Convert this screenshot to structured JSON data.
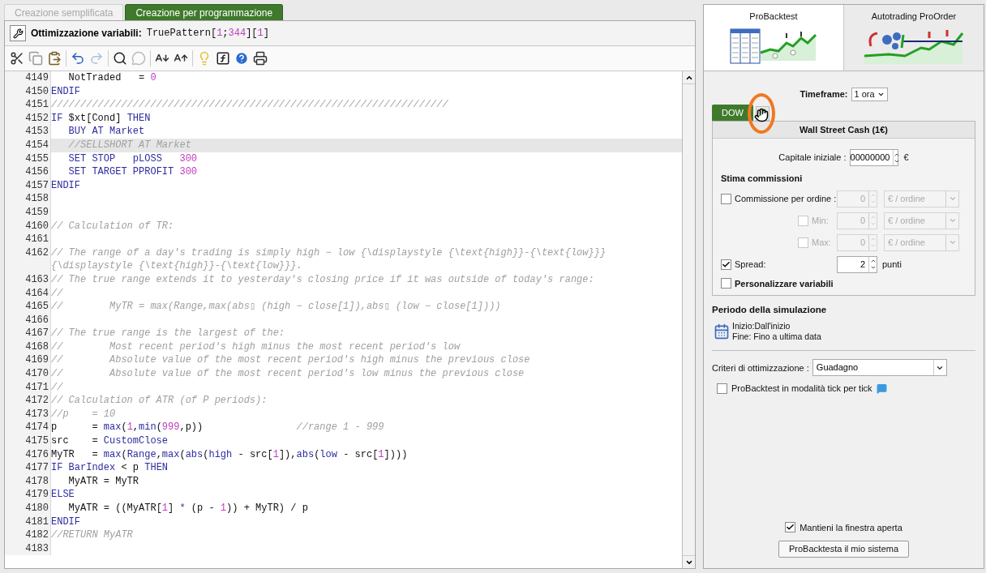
{
  "tabs": [
    {
      "label": "Creazione semplificata",
      "selected": false
    },
    {
      "label": "Creazione per programmazione",
      "selected": true
    }
  ],
  "optimization": {
    "label": "Ottimizzazione variabili:",
    "tokens": [
      {
        "kind": "plain",
        "text": "TruePattern["
      },
      {
        "kind": "num",
        "text": "1"
      },
      {
        "kind": "plain",
        "text": ";"
      },
      {
        "kind": "num",
        "text": "344"
      },
      {
        "kind": "plain",
        "text": "]["
      },
      {
        "kind": "num",
        "text": "1"
      },
      {
        "kind": "plain",
        "text": "]"
      }
    ]
  },
  "code_lines": [
    {
      "number": "4149",
      "highlighted": false,
      "tokens": [
        {
          "kind": "plain",
          "text": "   NotTraded   = "
        },
        {
          "kind": "num",
          "text": "0"
        }
      ]
    },
    {
      "number": "4150",
      "highlighted": false,
      "tokens": [
        {
          "kind": "kw",
          "text": "ENDIF"
        }
      ]
    },
    {
      "number": "4151",
      "highlighted": false,
      "tokens": [
        {
          "kind": "comment",
          "text": "////////////////////////////////////////////////////////////////////"
        }
      ]
    },
    {
      "number": "4152",
      "highlighted": false,
      "tokens": [
        {
          "kind": "kw",
          "text": "IF"
        },
        {
          "kind": "plain",
          "text": " $xt[Cond] "
        },
        {
          "kind": "kw",
          "text": "THEN"
        }
      ]
    },
    {
      "number": "4153",
      "highlighted": false,
      "tokens": [
        {
          "kind": "kw",
          "text": "   BUY AT Market"
        }
      ]
    },
    {
      "number": "4154",
      "highlighted": true,
      "tokens": [
        {
          "kind": "comment",
          "text": "   //SELLSHORT AT Market"
        }
      ]
    },
    {
      "number": "4155",
      "highlighted": false,
      "tokens": [
        {
          "kind": "kw",
          "text": "   SET STOP   pLOSS"
        },
        {
          "kind": "num",
          "text": "   300"
        }
      ]
    },
    {
      "number": "4156",
      "highlighted": false,
      "tokens": [
        {
          "kind": "kw",
          "text": "   SET TARGET PPROFIT"
        },
        {
          "kind": "num",
          "text": " 300"
        }
      ]
    },
    {
      "number": "4157",
      "highlighted": false,
      "tokens": [
        {
          "kind": "kw",
          "text": "ENDIF"
        }
      ]
    },
    {
      "number": "4158",
      "highlighted": false
    },
    {
      "number": "4159",
      "highlighted": false
    },
    {
      "number": "4160",
      "highlighted": false,
      "tokens": [
        {
          "kind": "comment",
          "text": "// Calculation of TR:"
        }
      ]
    },
    {
      "number": "4161",
      "highlighted": false
    },
    {
      "number": "4162",
      "highlighted": false,
      "tokens": [
        {
          "kind": "comment",
          "text": "// The range of a day's trading is simply high − low {\\displaystyle {\\text{high}}-{\\text{low}}} {\\displaystyle {\\text{high}}-{\\text{low}}}."
        }
      ]
    },
    {
      "number": "4163",
      "highlighted": false,
      "tokens": [
        {
          "kind": "comment",
          "text": "// The true range extends it to yesterday's closing price if it was outside of today's range:"
        }
      ]
    },
    {
      "number": "4164",
      "highlighted": false,
      "tokens": [
        {
          "kind": "comment",
          "text": "//"
        }
      ]
    },
    {
      "number": "4165",
      "highlighted": false,
      "tokens": [
        {
          "kind": "comment",
          "text": "//        MyTR = max(Range,max(abs▯ (high − close[1]),abs▯ (low − close[1])))"
        }
      ]
    },
    {
      "number": "4166",
      "highlighted": false
    },
    {
      "number": "4167",
      "highlighted": false,
      "tokens": [
        {
          "kind": "comment",
          "text": "// The true range is the largest of the:"
        }
      ]
    },
    {
      "number": "4168",
      "highlighted": false,
      "tokens": [
        {
          "kind": "comment",
          "text": "//        Most recent period's high minus the most recent period's low"
        }
      ]
    },
    {
      "number": "4169",
      "highlighted": false,
      "tokens": [
        {
          "kind": "comment",
          "text": "//        Absolute value of the most recent period's high minus the previous close"
        }
      ]
    },
    {
      "number": "4170",
      "highlighted": false,
      "tokens": [
        {
          "kind": "comment",
          "text": "//        Absolute value of the most recent period's low minus the previous close"
        }
      ]
    },
    {
      "number": "4171",
      "highlighted": false,
      "tokens": [
        {
          "kind": "comment",
          "text": "//"
        }
      ]
    },
    {
      "number": "4172",
      "highlighted": false,
      "tokens": [
        {
          "kind": "comment",
          "text": "// Calculation of ATR (of P periods):"
        }
      ]
    },
    {
      "number": "4173",
      "highlighted": false,
      "tokens": [
        {
          "kind": "comment",
          "text": "//p    = 10"
        }
      ]
    },
    {
      "number": "4174",
      "highlighted": false,
      "tokens": [
        {
          "kind": "plain",
          "text": "p      = "
        },
        {
          "kind": "kw",
          "text": "max"
        },
        {
          "kind": "plain",
          "text": "("
        },
        {
          "kind": "num",
          "text": "1"
        },
        {
          "kind": "plain",
          "text": ","
        },
        {
          "kind": "kw",
          "text": "min"
        },
        {
          "kind": "plain",
          "text": "("
        },
        {
          "kind": "num",
          "text": "999"
        },
        {
          "kind": "plain",
          "text": ",p))                "
        },
        {
          "kind": "comment",
          "text": "//range 1 - 999"
        }
      ]
    },
    {
      "number": "4175",
      "highlighted": false,
      "tokens": [
        {
          "kind": "plain",
          "text": "src    = "
        },
        {
          "kind": "kw",
          "text": "CustomClose"
        }
      ]
    },
    {
      "number": "4176",
      "highlighted": false,
      "tokens": [
        {
          "kind": "plain",
          "text": "MyTR   = "
        },
        {
          "kind": "kw",
          "text": "max"
        },
        {
          "kind": "plain",
          "text": "("
        },
        {
          "kind": "kw",
          "text": "Range"
        },
        {
          "kind": "plain",
          "text": ","
        },
        {
          "kind": "kw",
          "text": "max"
        },
        {
          "kind": "plain",
          "text": "("
        },
        {
          "kind": "kw",
          "text": "abs"
        },
        {
          "kind": "plain",
          "text": "("
        },
        {
          "kind": "kw",
          "text": "high"
        },
        {
          "kind": "plain",
          "text": " - src["
        },
        {
          "kind": "num",
          "text": "1"
        },
        {
          "kind": "plain",
          "text": "]),"
        },
        {
          "kind": "kw",
          "text": "abs"
        },
        {
          "kind": "plain",
          "text": "("
        },
        {
          "kind": "kw",
          "text": "low"
        },
        {
          "kind": "plain",
          "text": " - src["
        },
        {
          "kind": "num",
          "text": "1"
        },
        {
          "kind": "plain",
          "text": "])))"
        }
      ]
    },
    {
      "number": "4177",
      "highlighted": false,
      "tokens": [
        {
          "kind": "kw",
          "text": "IF BarIndex"
        },
        {
          "kind": "plain",
          "text": " < p "
        },
        {
          "kind": "kw",
          "text": "THEN"
        }
      ]
    },
    {
      "number": "4178",
      "highlighted": false,
      "tokens": [
        {
          "kind": "plain",
          "text": "   MyATR = MyTR"
        }
      ]
    },
    {
      "number": "4179",
      "highlighted": false,
      "tokens": [
        {
          "kind": "kw",
          "text": "ELSE"
        }
      ]
    },
    {
      "number": "4180",
      "highlighted": false,
      "tokens": [
        {
          "kind": "plain",
          "text": "   MyATR = ((MyATR["
        },
        {
          "kind": "num",
          "text": "1"
        },
        {
          "kind": "plain",
          "text": "] "
        },
        {
          "kind": "kw",
          "text": "*"
        },
        {
          "kind": "plain",
          "text": " (p - "
        },
        {
          "kind": "num",
          "text": "1"
        },
        {
          "kind": "plain",
          "text": ")) + MyTR) / p"
        }
      ]
    },
    {
      "number": "4181",
      "highlighted": false,
      "tokens": [
        {
          "kind": "kw",
          "text": "ENDIF"
        }
      ]
    },
    {
      "number": "4182",
      "highlighted": false,
      "tokens": [
        {
          "kind": "comment",
          "text": "//RETURN MyATR"
        }
      ]
    },
    {
      "number": "4183",
      "highlighted": false
    }
  ],
  "mode_tabs": [
    {
      "label": "ProBacktest",
      "selected": true
    },
    {
      "label": "Autotrading ProOrder",
      "selected": false
    }
  ],
  "timeframe": {
    "label": "Timeframe:",
    "value": "1 ora"
  },
  "instrument_tab": "DOW",
  "instrument_title": "Wall Street Cash (1€)",
  "capital": {
    "label": "Capitale iniziale :",
    "value": "00000000",
    "unit": "€"
  },
  "commissions_title": "Stima commissioni",
  "commission_rows": [
    {
      "label": "Commissione per ordine :",
      "checked": false,
      "disabled": false,
      "value": "0",
      "unit": "€ / ordine"
    },
    {
      "label": "Min:",
      "checked": false,
      "disabled": true,
      "value": "0",
      "unit": "€ / ordine"
    },
    {
      "label": "Max:",
      "checked": false,
      "disabled": true,
      "value": "0",
      "unit": "€ / ordine"
    }
  ],
  "spread": {
    "label": "Spread:",
    "checked": true,
    "value": "2",
    "unit": "punti"
  },
  "custom_vars": {
    "label": "Personalizzare variabili",
    "checked": false
  },
  "period": {
    "title": "Periodo della simulazione",
    "start": "Inizio:Dall'inizio",
    "end": "Fine: Fino a ultima data"
  },
  "criteria": {
    "label": "Criteri di ottimizzazione :",
    "value": "Guadagno"
  },
  "tick_mode": {
    "label": "ProBacktest in modalità tick per tick",
    "checked": false
  },
  "keep_open": {
    "label": "Mantieni la finestra aperta",
    "checked": true
  },
  "run_button": "ProBacktesta il mio sistema"
}
